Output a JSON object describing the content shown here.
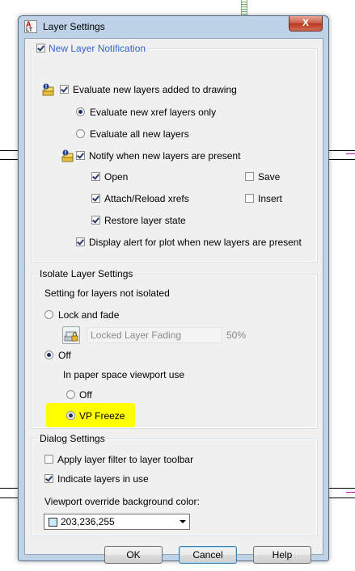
{
  "window": {
    "title": "Layer Settings",
    "app_icon_text_top": "A",
    "app_icon_text_bottom": "LT",
    "close_glyph": "X"
  },
  "notification_group": {
    "new_layer_notification": {
      "label": "New Layer Notification",
      "checked": true
    },
    "evaluate_new_layers": {
      "label": "Evaluate new layers added to drawing",
      "checked": true
    },
    "evaluate_xref_only": {
      "label": "Evaluate new xref layers only",
      "selected": true
    },
    "evaluate_all": {
      "label": "Evaluate all new layers",
      "selected": false
    },
    "notify_present": {
      "label": "Notify when new layers are present",
      "checked": true
    },
    "open": {
      "label": "Open",
      "checked": true
    },
    "save": {
      "label": "Save",
      "checked": false
    },
    "attach_reload": {
      "label": "Attach/Reload xrefs",
      "checked": true
    },
    "insert": {
      "label": "Insert",
      "checked": false
    },
    "restore_state": {
      "label": "Restore layer state",
      "checked": true
    },
    "display_alert": {
      "label": "Display alert for plot when new layers are present",
      "checked": true
    }
  },
  "isolate_group": {
    "title": "Isolate Layer Settings",
    "setting_label": "Setting for layers not isolated",
    "lock_and_fade": {
      "label": "Lock and fade",
      "selected": false
    },
    "locked_fading_label": "Locked Layer Fading",
    "locked_fading_value": "50%",
    "off": {
      "label": "Off",
      "selected": true
    },
    "paper_space_label": "In paper space viewport use",
    "ps_off": {
      "label": "Off",
      "selected": false
    },
    "vp_freeze": {
      "label": "VP Freeze",
      "selected": true
    }
  },
  "dialog_group": {
    "title": "Dialog Settings",
    "apply_filter": {
      "label": "Apply layer filter to layer toolbar",
      "checked": false
    },
    "indicate_in_use": {
      "label": "Indicate layers in use",
      "checked": true
    },
    "viewport_color_label": "Viewport override background color:",
    "viewport_color_value": "203,236,255",
    "swatch_color": "#cbecff"
  },
  "buttons": {
    "ok": "OK",
    "cancel": "Cancel",
    "help": "Help"
  },
  "colors": {
    "highlight": "#ffff00",
    "link_blue": "#3366cc"
  }
}
